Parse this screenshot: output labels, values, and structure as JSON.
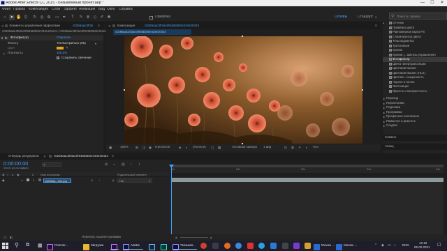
{
  "window": {
    "title": "Adobe After Effects CC 2015 - Безымянный проект.aep *",
    "minimize": "—",
    "maximize": "☐",
    "close": "✕"
  },
  "menu": [
    "Файл",
    "Правка",
    "Композиция",
    "Слой",
    "Эффект",
    "Анимация",
    "Вид",
    "Окно",
    "Справка"
  ],
  "toolbar": {
    "snap_label": "Привязка",
    "workspaces": [
      "Основы",
      "Стандарт"
    ],
    "selected_workspace": "Основы",
    "search_placeholder": "Поиск в справке"
  },
  "effects_panel": {
    "tab_label": "Элементы управления эффектами",
    "tab_file": "c0266aac3ff3a",
    "header_path": "c0266aac3ff3ac0f946b0b0e434e20424 • c0266aac3ff3ac0f946b0b0e434e20424",
    "effect_name": "Фотофильтр",
    "effect_reset": "Сбросить",
    "rows": [
      {
        "label": "Фильтр",
        "value": "Теплый фильтр (85)"
      },
      {
        "label": "Цвет",
        "value": ""
      },
      {
        "label": "Плотность",
        "value": "100,0%"
      },
      {
        "label": "",
        "value": "Сохранить свечение"
      }
    ]
  },
  "comp_panel": {
    "tab_label": "Композиция",
    "tab_name": "c0266aac3ff3ac0f946b0b0e434e20424",
    "breadcrumb": "c0266aac3ff3ac0f946b0b0e434e20424"
  },
  "viewer_bar": {
    "zoom": "100%",
    "timecode": "0:00:00:00",
    "resolution": "(Полное)",
    "camera": "Активная камера",
    "views": "1 вид",
    "exposure": "+0,0"
  },
  "effects_presets": {
    "items": [
      "Оттенок",
      "Привязка цвета",
      "Равномерная карта PS",
      "Стабилизатор цвета",
      "Тень/подсветка",
      "Тритоновый",
      "Уровни",
      "Уровни (...аметры управления)",
      "Фотофильтр",
      "Цвета гипертрансляции",
      "Цветовой баланс",
      "Цветовой баланс (HLS)",
      "Цветово...сыщенность",
      "Черное и белое",
      "Экспозиция",
      "Яркость и контрастность"
    ],
    "highlighted_index": 8,
    "categories": [
      "Переход",
      "Перспектива",
      "Подложка",
      "Программа",
      "Прозрачное наложение",
      "Размытие и резкость",
      "Создать"
    ],
    "lower_panels": [
      "Символ",
      "Абзац"
    ]
  },
  "timeline": {
    "tabs": [
      "Очередь рендеринга",
      "c0266aac3ff3ac0f946b0b0e434e20424"
    ],
    "timecode": "0:00:00:00",
    "fps": "00000 (25,00 кадр/с)",
    "columns": [
      "#",
      "Имя источника",
      "Родительский элемент"
    ],
    "layer": {
      "num": "1",
      "name": "c0266aa...424.jpg",
      "parent": "Нет"
    },
    "ruler_ticks": [
      "0s",
      "01s",
      "02s",
      "03s",
      "04s",
      "05s"
    ],
    "status": "Переклю. выключ./режимы"
  },
  "taskbar": {
    "apps": [
      "Premier...",
      "Загрузки",
      "Adobe...",
      "Adobe",
      "*Безымя...",
      "Movavi ...",
      "Movavi ..."
    ],
    "lang": "ENG",
    "time": "12:15",
    "date": "05.02.2021"
  },
  "colors": {
    "accent": "#3ea2ff",
    "layer_bar": "#8b9b9b",
    "highlight": "#3a3a3a"
  }
}
